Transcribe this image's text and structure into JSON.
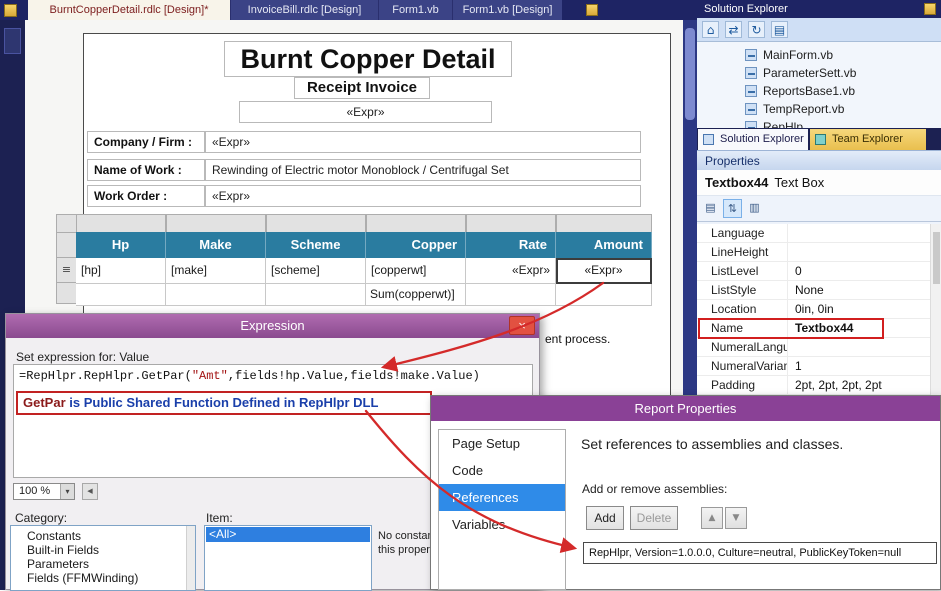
{
  "icons": {
    "close": "×",
    "dropdown": "▾",
    "up": "▲",
    "down": "▼",
    "refresh": "↻",
    "home": "⌂",
    "sync": "⇄",
    "grid": "▤",
    "sort": "⇅",
    "pages": "▥",
    "row_handle": "≡",
    "scroll_left": "◀"
  },
  "topbar": {
    "tabs": [
      {
        "label": "BurntCopperDetail.rdlc [Design]*"
      },
      {
        "label": "InvoiceBill.rdlc [Design]"
      },
      {
        "label": "Form1.vb"
      },
      {
        "label": "Form1.vb [Design]"
      }
    ]
  },
  "report": {
    "title": "Burnt Copper Detail",
    "subtitle": "Receipt Invoice",
    "expr_top": "«Expr»",
    "fields": [
      {
        "label": "Company / Firm :",
        "value": "«Expr»"
      },
      {
        "label": "Name of Work :",
        "value": "Rewinding of Electric motor Monoblock / Centrifugal Set"
      },
      {
        "label": "Work Order :",
        "value": "«Expr»"
      }
    ],
    "table": {
      "headers": [
        "Hp",
        "Make",
        "Scheme",
        "Copper",
        "Rate",
        "Amount"
      ],
      "data_row": [
        "[hp]",
        "[make]",
        "[scheme]",
        "[copperwt]",
        "«Expr»",
        "«Expr»"
      ],
      "footer_copper": "Sum(copperwt)]"
    },
    "partial_text": "ent process."
  },
  "solution_explorer": {
    "title": "Solution Explorer",
    "files": [
      "MainForm.vb",
      "ParameterSett.vb",
      "ReportsBase1.vb",
      "TempReport.vb",
      "RepHlp"
    ],
    "tabs": [
      "Solution Explorer",
      "Team Explorer"
    ]
  },
  "properties": {
    "title": "Properties",
    "object_name": "Textbox44",
    "object_type": "Text Box",
    "rows": [
      {
        "label": "Language",
        "value": ""
      },
      {
        "label": "LineHeight",
        "value": ""
      },
      {
        "label": "ListLevel",
        "value": "0"
      },
      {
        "label": "ListStyle",
        "value": "None"
      },
      {
        "label": "Location",
        "value": "0in, 0in"
      },
      {
        "label": "Name",
        "value": "Textbox44"
      },
      {
        "label": "NumeralLanguag",
        "value": ""
      },
      {
        "label": "NumeralVariant",
        "value": "1"
      },
      {
        "label": "Padding",
        "value": "2pt, 2pt, 2pt, 2pt"
      }
    ]
  },
  "expression_dialog": {
    "title": "Expression",
    "set_label": "Set expression for: Value",
    "expr_prefix": "=RepHlpr.RepHlpr.GetPar(",
    "expr_string": "\"Amt\"",
    "expr_suffix": ",fields!hp.Value,fields!make.Value)",
    "annotation_1": "GetPar",
    "annotation_2": " is Public Shared Function Defined in RepHlpr DLL",
    "zoom": "100 %",
    "category_label": "Category:",
    "item_label": "Item:",
    "categories": [
      "Constants",
      "Built-in Fields",
      "Parameters",
      "Fields (FFMWinding)"
    ],
    "item_selected": "<All>",
    "note_line1": "No constan",
    "note_line2": "this propert"
  },
  "report_properties": {
    "title": "Report Properties",
    "nav": [
      "Page Setup",
      "Code",
      "References",
      "Variables"
    ],
    "heading": "Set references to assemblies and classes.",
    "add_remove_label": "Add or remove assemblies:",
    "add_label": "Add",
    "delete_label": "Delete",
    "assembly": "RepHlpr, Version=1.0.0.0, Culture=neutral, PublicKeyToken=null"
  }
}
